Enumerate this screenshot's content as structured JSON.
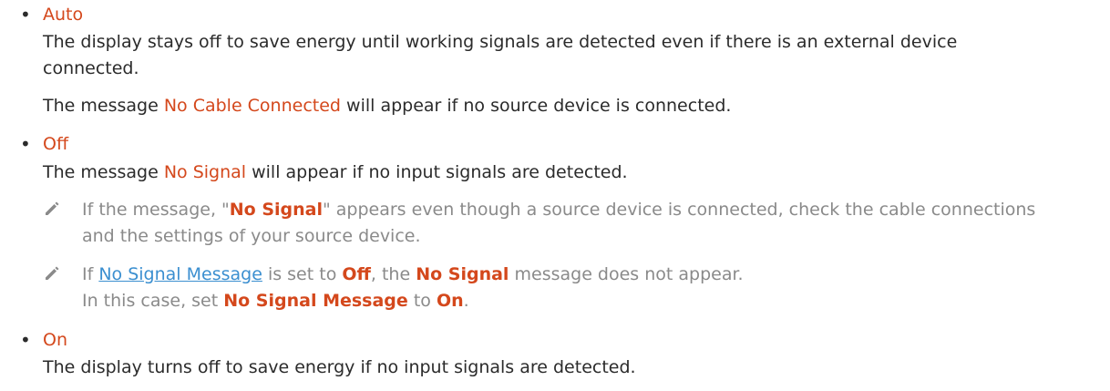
{
  "options": [
    {
      "label": "Auto",
      "body": [
        "The display stays off to save energy until working signals are detected even if there is an external device",
        "connected."
      ],
      "message_line": {
        "prefix": "The message ",
        "highlight": "No Cable Connected",
        "suffix": " will appear if no source device is connected."
      }
    },
    {
      "label": "Off",
      "message_line": {
        "prefix": "The message ",
        "highlight": "No Signal",
        "suffix": " will appear if no input signals are detected."
      },
      "notes": [
        {
          "icon": "pencil-icon",
          "line1_prefix": "If the message, \"",
          "line1_bold": "No Signal",
          "line1_suffix": "\" appears even though a source device is connected, check the cable connections",
          "line2": "and the settings of your source device."
        },
        {
          "icon": "pencil-icon",
          "prefix": "If ",
          "link": "No Signal Message",
          "mid1": " is set to ",
          "bold1": "Off",
          "mid2": ", the ",
          "bold2": "No Signal",
          "suffix": " message does not appear.",
          "line2_prefix": "In this case, set ",
          "line2_bold1": "No Signal Message",
          "line2_mid": " to ",
          "line2_bold2": "On",
          "line2_suffix": "."
        }
      ]
    },
    {
      "label": "On",
      "body": [
        "The display turns off to save energy if no input signals are detected."
      ]
    }
  ],
  "bullet_char": "•",
  "colors": {
    "highlight": "#d4481c",
    "note": "#8a8a8a",
    "link": "#3b8fd0",
    "text": "#2b2b2b"
  }
}
